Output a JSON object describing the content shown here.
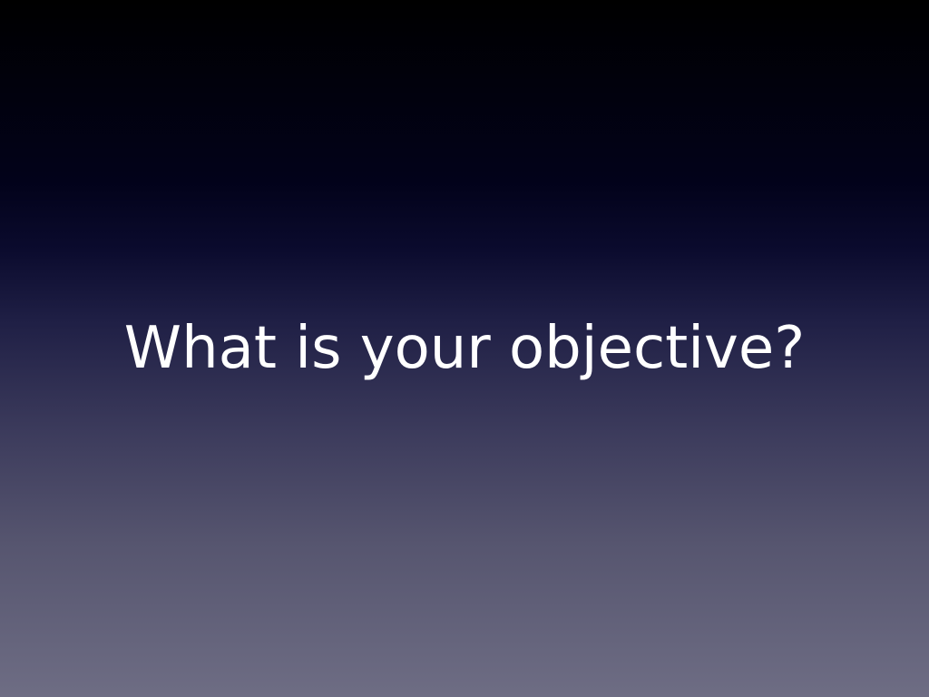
{
  "slide": {
    "title": "What is your objective?"
  }
}
